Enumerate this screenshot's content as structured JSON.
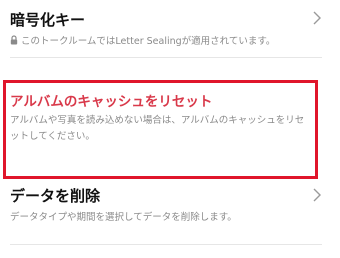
{
  "encryption": {
    "title": "暗号化キー",
    "description": "このトークルームではLetter Sealingが適用されています。",
    "icons": [
      "lock-icon",
      "chevron-right-icon"
    ]
  },
  "reset_cache": {
    "title": "アルバムのキャッシュをリセット",
    "description": "アルバムや写真を読み込めない場合は、アルバムのキャッシュをリセットしてください。",
    "highlight_color": "#e0162b",
    "title_color": "#d9394a"
  },
  "delete_data": {
    "title": "データを削除",
    "description": "データタイプや期間を選択してデータを削除します。",
    "icons": [
      "chevron-right-icon"
    ]
  }
}
